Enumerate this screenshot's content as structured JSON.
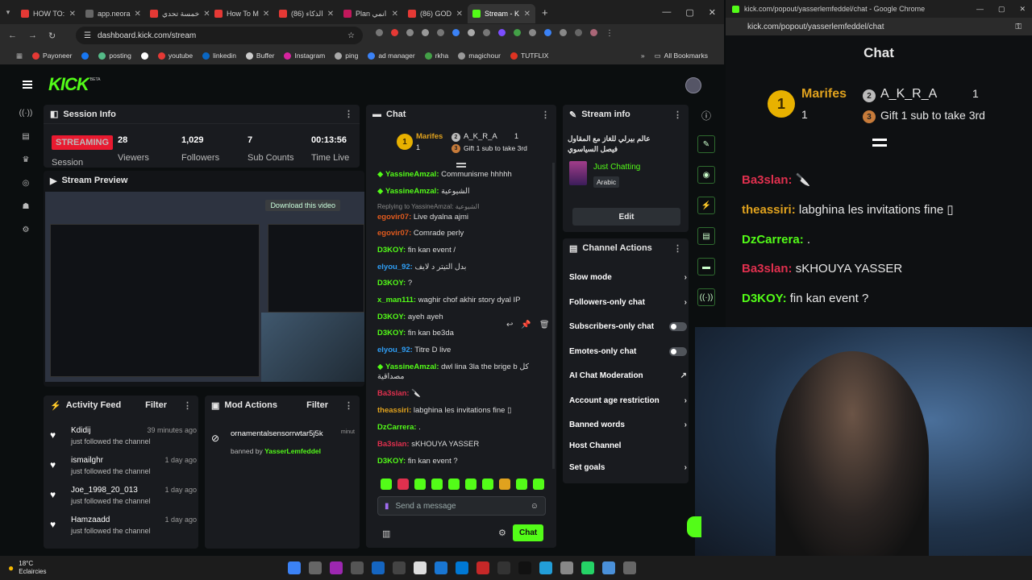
{
  "browser": {
    "tabs": [
      {
        "label": "HOW TO:"
      },
      {
        "label": "app.neora"
      },
      {
        "label": "خمسة تحدي"
      },
      {
        "label": "How To M"
      },
      {
        "label": "(86) الذكاء"
      },
      {
        "label": "Plan انمي"
      },
      {
        "label": "(86) GOD"
      },
      {
        "label": "Stream - K"
      }
    ],
    "url": "dashboard.kick.com/stream",
    "bookmarks": [
      "Payoneer",
      "posting",
      "youtube",
      "linkedin",
      "Buffer",
      "Instagram",
      "ping",
      "ad manager",
      "rkha",
      "magichour",
      "TUTFLIX"
    ],
    "all_bookmarks": "All Bookmarks"
  },
  "app": {
    "logo": "KICK",
    "logo_badge": "BETA"
  },
  "session": {
    "title": "Session Info",
    "status": "STREAMING",
    "status_label": "Session",
    "viewers_value": "28",
    "viewers_label": "Viewers",
    "followers_value": "1,029",
    "followers_label": "Followers",
    "subs_value": "7",
    "subs_label": "Sub Counts",
    "time_value": "00:13:56",
    "time_label": "Time Live"
  },
  "preview": {
    "title": "Stream Preview",
    "download": "Download this video"
  },
  "activity": {
    "title": "Activity Feed",
    "filter": "Filter",
    "items": [
      {
        "name": "Kdidij",
        "text": "just followed the channel",
        "time": "39 minutes ago"
      },
      {
        "name": "ismailghr",
        "text": "just followed the channel",
        "time": "1 day ago"
      },
      {
        "name": "Joe_1998_20_013",
        "text": "just followed the channel",
        "time": "1 day ago"
      },
      {
        "name": "Hamzaadd",
        "text": "just followed the channel",
        "time": "1 day ago"
      }
    ]
  },
  "mod": {
    "title": "Mod Actions",
    "filter": "Filter",
    "user": "ornamentalsensorrwtar5j5k",
    "time": "minut",
    "by_prefix": "banned by",
    "by_user": "YasserLemfeddel"
  },
  "chat": {
    "title": "Chat",
    "top1": "Marifes",
    "top1_count": "1",
    "top2": "A_K_R_A",
    "top2_count": "1",
    "gift": "Gift 1 sub to take 3rd",
    "reply_to": "Replying to YassineAmzal: الشيوعية",
    "messages": [
      {
        "user": "YassineAmzal:",
        "text": "Communisme hhhhh",
        "color": "#53fc18"
      },
      {
        "user": "YassineAmzal:",
        "text": "الشيوعية",
        "color": "#53fc18"
      },
      {
        "user": "egovir07:",
        "text": "Live dyalna ajmi",
        "color": "#e05a1e"
      },
      {
        "user": "egovir07:",
        "text": "Comrade perly",
        "color": "#e05a1e"
      },
      {
        "user": "D3KOY:",
        "text": "fin kan event /",
        "color": "#53fc18"
      },
      {
        "user": "elyou_92:",
        "text": "بدل التيتر د لايف",
        "color": "#2f9ef5"
      },
      {
        "user": "D3KOY:",
        "text": "?",
        "color": "#53fc18"
      },
      {
        "user": "x_man111:",
        "text": "waghir chof akhir story dyal IP",
        "color": "#53fc18"
      },
      {
        "user": "D3KOY:",
        "text": "ayeh ayeh",
        "color": "#53fc18"
      },
      {
        "user": "D3KOY:",
        "text": "fin kan be3da",
        "color": "#53fc18"
      },
      {
        "user": "elyou_92:",
        "text": "Titre D live",
        "color": "#2f9ef5"
      },
      {
        "user": "YassineAmzal:",
        "text": "dwl lina 3la the brige b كل",
        "color": "#53fc18"
      },
      {
        "user": "",
        "text": "مصداقية",
        "color": "#e05a1e"
      },
      {
        "user": "Ba3slan:",
        "text": "🔪",
        "color": "#e0304e"
      },
      {
        "user": "theassiri:",
        "text": "labghina les invitations fine ▯",
        "color": "#e0a21e"
      },
      {
        "user": "DzCarrera:",
        "text": ".",
        "color": "#53fc18"
      },
      {
        "user": "Ba3slan:",
        "text": "sKHOUYA YASSER",
        "color": "#e0304e"
      },
      {
        "user": "D3KOY:",
        "text": "fin kan event ?",
        "color": "#53fc18"
      }
    ],
    "placeholder": "Send a message",
    "send": "Chat"
  },
  "stream_info": {
    "title": "Stream info",
    "stream_title": "عالم بيرلي للغاز مع المقاول فيصل السياسوي",
    "category": "Just Chatting",
    "language": "Arabic",
    "edit": "Edit"
  },
  "channel_actions": {
    "title": "Channel Actions",
    "items": [
      {
        "label": "Slow mode",
        "kind": "arrow"
      },
      {
        "label": "Followers-only chat",
        "kind": "arrow"
      },
      {
        "label": "Subscribers-only chat",
        "kind": "toggle"
      },
      {
        "label": "Emotes-only chat",
        "kind": "toggle"
      },
      {
        "label": "AI Chat Moderation",
        "kind": "external"
      },
      {
        "label": "Account age restriction",
        "kind": "arrow"
      },
      {
        "label": "Banned words",
        "kind": "arrow"
      },
      {
        "label": "Host Channel",
        "kind": "none"
      },
      {
        "label": "Set goals",
        "kind": "arrow"
      }
    ]
  },
  "popout": {
    "window_title": "kick.com/popout/yasserlemfeddel/chat - Google Chrome",
    "url": "kick.com/popout/yasserlemfeddel/chat",
    "heading": "Chat",
    "top1": "Marifes",
    "top1_count": "1",
    "top2": "A_K_R_A",
    "top2_count": "1",
    "gift": "Gift 1 sub to take 3rd",
    "messages": [
      {
        "user": "Ba3slan:",
        "text": "🔪",
        "color": "#e0304e"
      },
      {
        "user": "theassiri:",
        "text": "labghina les invitations fine ▯",
        "color": "#e0a21e"
      },
      {
        "user": "DzCarrera:",
        "text": ".",
        "color": "#53fc18"
      },
      {
        "user": "Ba3slan:",
        "text": "sKHOUYA YASSER",
        "color": "#e0304e"
      },
      {
        "user": "D3KOY:",
        "text": "fin kan event ?",
        "color": "#53fc18"
      }
    ]
  },
  "taskbar": {
    "temp": "18°C",
    "weather": "Eclaircies"
  },
  "colors": {
    "accent": "#53fc18",
    "live": "#e91a30",
    "panel": "#191b1f"
  }
}
